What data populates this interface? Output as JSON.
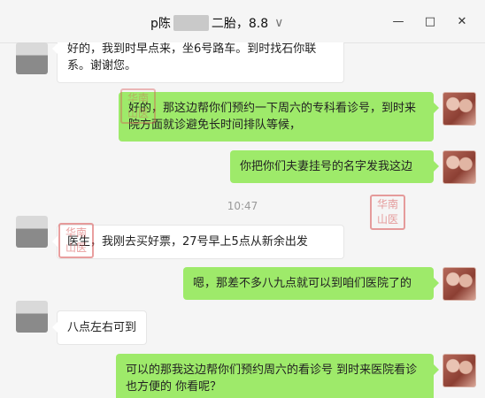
{
  "window": {
    "title_prefix": "p陈",
    "title_suffix": "二胎，8.8",
    "dropdown_glyph": "∨",
    "minimize_glyph": "—",
    "maximize_glyph": "□",
    "close_glyph": "✕"
  },
  "stamp": {
    "text": "华南山医"
  },
  "messages": [
    {
      "text": "好的，我到时早点来，坐6号路车。到时找石你联系。谢谢您。"
    },
    {
      "text": "好的，那这边帮你们预约一下周六的专科看诊号，到时来院方面就诊避免长时间排队等候，"
    },
    {
      "text": "你把你们夫妻挂号的名字发我这边"
    },
    {
      "text": "医生，我刚去买好票，27号早上5点从新余出发"
    },
    {
      "text": "嗯，那差不多八九点就可以到咱们医院了的"
    },
    {
      "text": "八点左右可到"
    },
    {
      "text": "可以的那我这边帮你们预约周六的看诊号 到时来医院看诊也方便的  你看呢？"
    }
  ],
  "timestamp": "10:47"
}
